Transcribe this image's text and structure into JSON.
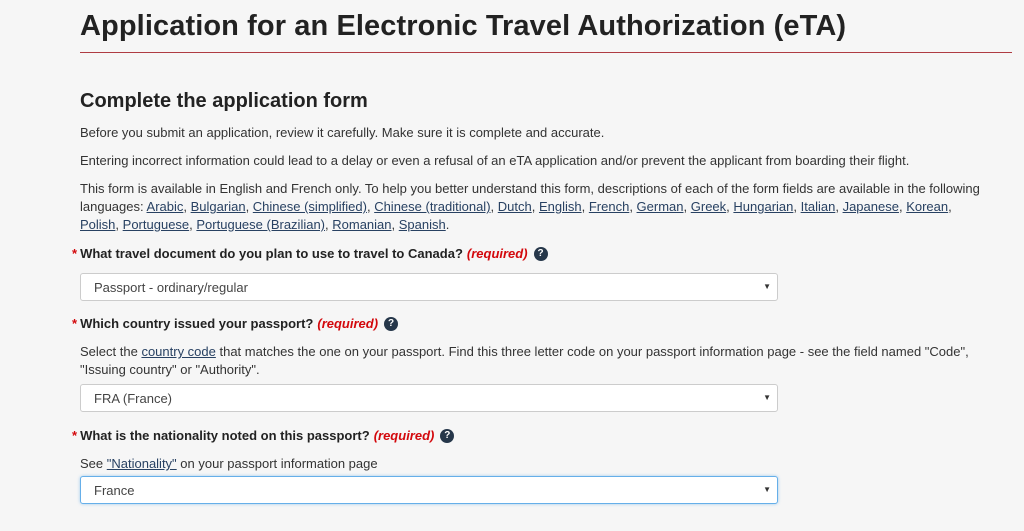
{
  "page": {
    "title": "Application for an Electronic Travel Authorization (eTA)",
    "section_title": "Complete the application form",
    "intro1": "Before you submit an application, review it carefully. Make sure it is complete and accurate.",
    "intro2": "Entering incorrect information could lead to a delay or even a refusal of an eTA application and/or prevent the applicant from boarding their flight.",
    "intro3_text": "This form is available in English and French only. To help you better understand this form, descriptions of each of the form fields are available in the following languages:",
    "languages": [
      "Arabic",
      "Bulgarian",
      "Chinese (simplified)",
      "Chinese (traditional)",
      "Dutch",
      "English",
      "French",
      "German",
      "Greek",
      "Hungarian",
      "Italian",
      "Japanese",
      "Korean",
      "Polish",
      "Portuguese",
      "Portuguese (Brazilian)",
      "Romanian",
      "Spanish"
    ]
  },
  "questions": {
    "required_marker": "*",
    "required_label": "(required)",
    "help_glyph": "?",
    "q1": {
      "label": "What travel document do you plan to use to travel to Canada?",
      "value": "Passport - ordinary/regular"
    },
    "q2": {
      "label": "Which country issued your passport?",
      "hint_pre": "Select the ",
      "hint_link": "country code",
      "hint_post": " that matches the one on your passport.  Find this three letter code on your passport information page - see the field named \"Code\", \"Issuing country\" or \"Authority\".",
      "value": "FRA (France)"
    },
    "q3": {
      "label": "What is the nationality noted on this passport?",
      "hint_pre": "See ",
      "hint_link": "\"Nationality\"",
      "hint_post": " on your passport information page",
      "value": "France"
    }
  },
  "colors": {
    "accent_rule": "#af3c43",
    "required": "#d3080c",
    "link": "#284162",
    "help_icon": "#26374a"
  }
}
